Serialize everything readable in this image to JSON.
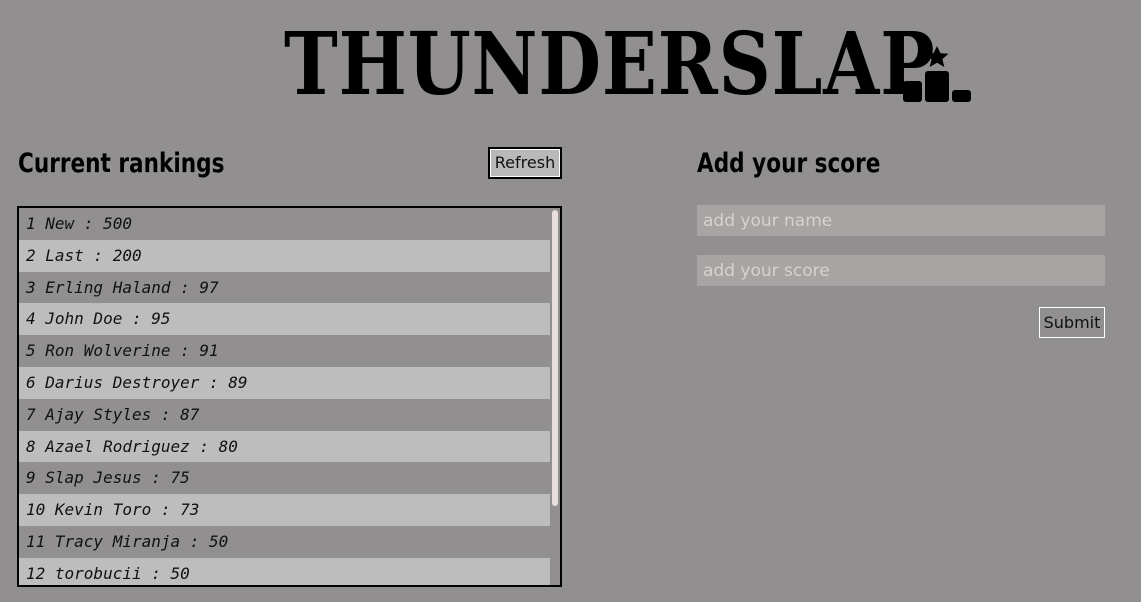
{
  "header": {
    "title": "THUNDERSLAP",
    "logo_icon": "podium-icon"
  },
  "rankings": {
    "heading": "Current rankings",
    "refresh_label": "Refresh",
    "entries": [
      "1 New : 500",
      "2 Last : 200",
      "3 Erling Haland : 97",
      "4 John Doe : 95",
      "5 Ron Wolverine : 91",
      "6 Darius Destroyer : 89",
      "7 Ajay Styles : 87",
      "8 Azael Rodriguez : 80",
      "9 Slap Jesus : 75",
      "10 Kevin Toro : 73",
      "11 Tracy Miranja : 50",
      "12 torobucii : 50"
    ]
  },
  "add_score": {
    "heading": "Add your score",
    "name_placeholder": "add your name",
    "score_placeholder": "add your score",
    "submit_label": "Submit"
  },
  "colors": {
    "background": "#918f90",
    "row_light": "#bdbdbd",
    "row_dark": "#918f90",
    "input_bg": "#a6a5a3"
  }
}
